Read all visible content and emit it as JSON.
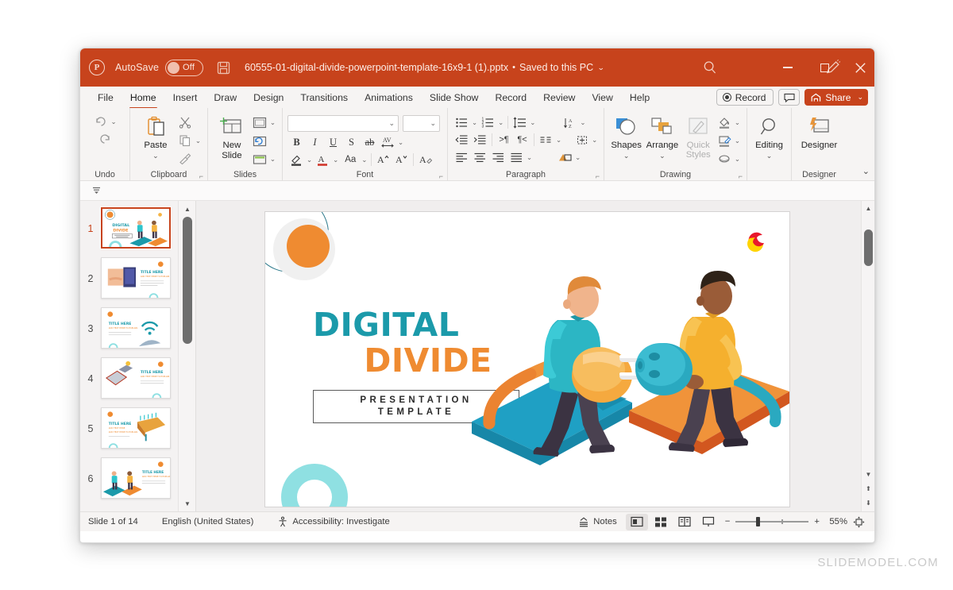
{
  "titlebar": {
    "app_icon": "powerpoint-logo-icon",
    "autosave_label": "AutoSave",
    "autosave_state": "Off",
    "save_icon": "save-icon",
    "filename": "60555-01-digital-divide-powerpoint-template-16x9-1 (1).pptx",
    "separator": "•",
    "save_location": "Saved to this PC",
    "search_icon": "search-icon",
    "pen_icon": "pen-annotation-icon",
    "minimize": "minimize-icon",
    "maximize": "maximize-icon",
    "close": "close-icon"
  },
  "tabs": [
    {
      "label": "File",
      "active": false
    },
    {
      "label": "Home",
      "active": true
    },
    {
      "label": "Insert",
      "active": false
    },
    {
      "label": "Draw",
      "active": false
    },
    {
      "label": "Design",
      "active": false
    },
    {
      "label": "Transitions",
      "active": false
    },
    {
      "label": "Animations",
      "active": false
    },
    {
      "label": "Slide Show",
      "active": false
    },
    {
      "label": "Record",
      "active": false
    },
    {
      "label": "Review",
      "active": false
    },
    {
      "label": "View",
      "active": false
    },
    {
      "label": "Help",
      "active": false
    }
  ],
  "tabs_right": {
    "record_label": "Record",
    "comments_icon": "comment-icon",
    "share_label": "Share",
    "share_caret": "⌄"
  },
  "ribbon": {
    "groups": [
      {
        "name": "Undo",
        "label": "Undo"
      },
      {
        "name": "Clipboard",
        "label": "Clipboard",
        "paste_label": "Paste",
        "dialog": true
      },
      {
        "name": "Slides",
        "label": "Slides",
        "new_slide_label": "New Slide"
      },
      {
        "name": "Font",
        "label": "Font",
        "font_value": "",
        "size_value": "",
        "dialog": true
      },
      {
        "name": "Paragraph",
        "label": "Paragraph",
        "dialog": true
      },
      {
        "name": "Drawing",
        "label": "Drawing",
        "shapes_label": "Shapes",
        "arrange_label": "Arrange",
        "quick_styles_label": "Quick Styles",
        "dialog": true
      },
      {
        "name": "Editing",
        "label": "",
        "editing_label": "Editing"
      },
      {
        "name": "Designer",
        "label": "Designer",
        "designer_label": "Designer"
      }
    ],
    "collapse_caret": "⌄"
  },
  "thumbnails": [
    {
      "number": "1",
      "selected": true
    },
    {
      "number": "2",
      "selected": false
    },
    {
      "number": "3",
      "selected": false
    },
    {
      "number": "4",
      "selected": false
    },
    {
      "number": "5",
      "selected": false
    },
    {
      "number": "6",
      "selected": false
    }
  ],
  "slide": {
    "title_line1": "DIGITAL",
    "title_line2": "DIVIDE",
    "subtitle_line1": "PRESENTATION",
    "subtitle_line2": "TEMPLATE",
    "colors": {
      "teal": "#1b9aaa",
      "orange": "#ef8b31",
      "light_teal": "#8fe0e2",
      "dark_teal_outline": "#2e7a8c",
      "logo_red": "#e8192c",
      "logo_yellow": "#ffd400"
    },
    "illustration": "two-men-with-plug-and-socket-on-platforms"
  },
  "statusbar": {
    "slide_counter": "Slide 1 of 14",
    "language": "English (United States)",
    "accessibility_icon": "accessibility-icon",
    "accessibility": "Accessibility: Investigate",
    "notes_label": "Notes",
    "notes_icon": "notes-icon",
    "view_normal_icon": "normal-view-icon",
    "view_sorter_icon": "slide-sorter-icon",
    "view_reading_icon": "reading-view-icon",
    "view_slideshow_icon": "slideshow-view-icon",
    "zoom_out": "−",
    "zoom_in": "+",
    "zoom_level": "55%",
    "fit_icon": "fit-to-window-icon"
  },
  "watermark": "SLIDEMODEL.COM"
}
